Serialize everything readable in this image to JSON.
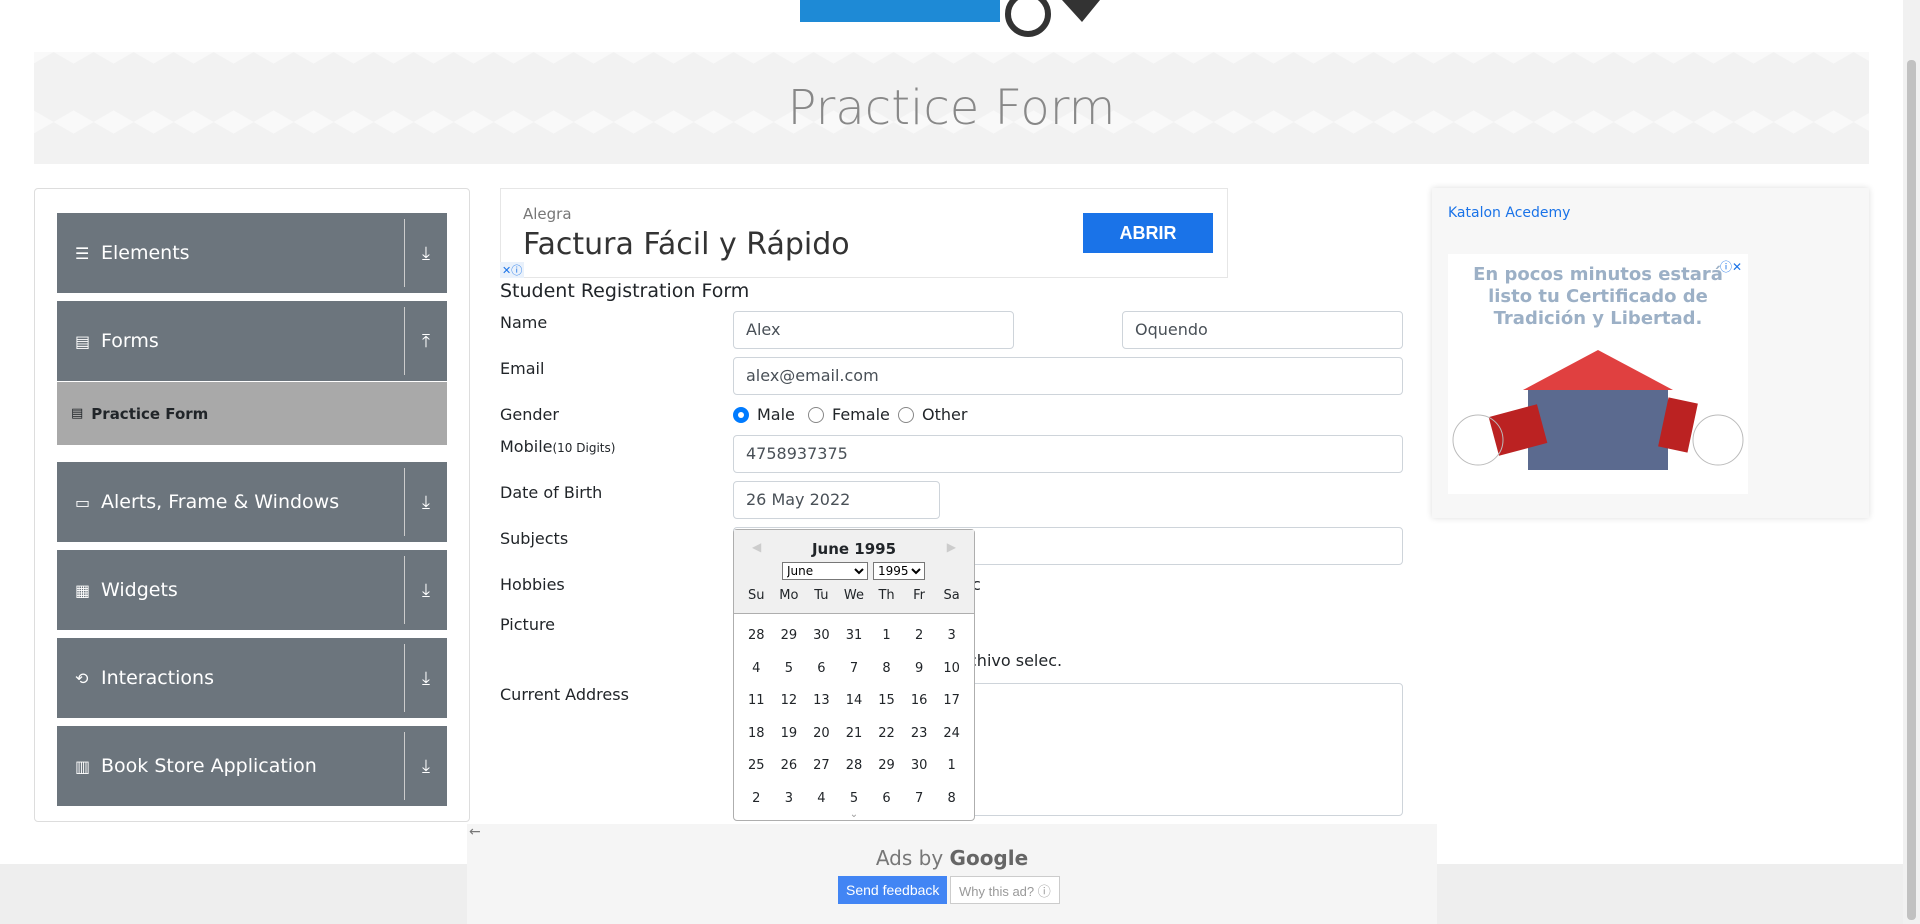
{
  "header": {
    "page_title": "Practice Form"
  },
  "sidebar": {
    "groups": [
      {
        "label": "Elements",
        "icon": "menu-icon"
      },
      {
        "label": "Forms",
        "icon": "form-icon"
      },
      {
        "label": "Alerts, Frame & Windows",
        "icon": "window-icon"
      },
      {
        "label": "Widgets",
        "icon": "widgets-icon"
      },
      {
        "label": "Interactions",
        "icon": "interactions-icon"
      },
      {
        "label": "Book Store Application",
        "icon": "books-icon"
      }
    ],
    "active_item": "Practice Form"
  },
  "top_ad": {
    "brand": "Alegra",
    "headline": "Factura Fácil y Rápido",
    "cta": "ABRIR"
  },
  "form": {
    "title": "Student Registration Form",
    "labels": {
      "name": "Name",
      "email": "Email",
      "gender": "Gender",
      "mobile": "Mobile",
      "mobile_hint": "(10 Digits)",
      "dob": "Date of Birth",
      "subjects": "Subjects",
      "hobbies": "Hobbies",
      "picture": "Picture",
      "address": "Current Address"
    },
    "first_name": "Alex",
    "last_name": "Oquendo",
    "email": "alex@email.com",
    "gender_options": [
      "Male",
      "Female",
      "Other"
    ],
    "gender_selected": "Male",
    "mobile": "4758937375",
    "dob": "26 May 2022",
    "hobbies_partial": "c",
    "picture_partial": "chivo selec."
  },
  "datepicker": {
    "title": "June 1995",
    "month_selected": "June",
    "year_selected": "1995",
    "day_names": [
      "Su",
      "Mo",
      "Tu",
      "We",
      "Th",
      "Fr",
      "Sa"
    ],
    "weeks": [
      [
        "28",
        "29",
        "30",
        "31",
        "1",
        "2",
        "3"
      ],
      [
        "4",
        "5",
        "6",
        "7",
        "8",
        "9",
        "10"
      ],
      [
        "11",
        "12",
        "13",
        "14",
        "15",
        "16",
        "17"
      ],
      [
        "18",
        "19",
        "20",
        "21",
        "22",
        "23",
        "24"
      ],
      [
        "25",
        "26",
        "27",
        "28",
        "29",
        "30",
        "1"
      ],
      [
        "2",
        "3",
        "4",
        "5",
        "6",
        "7",
        "8"
      ]
    ]
  },
  "side_ad": {
    "link": "Katalon Acedemy",
    "text": "En pocos minutos estará listo tu Certificado de Tradición y Libertad."
  },
  "bottom_ad": {
    "ads_by": "Ads by",
    "google": "Google",
    "send_feedback": "Send feedback",
    "why": "Why this ad? ⓘ"
  }
}
